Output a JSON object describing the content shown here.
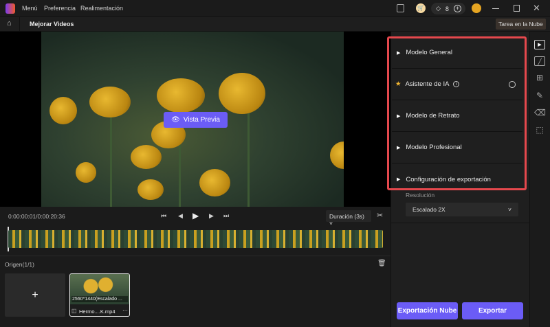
{
  "titlebar": {
    "menu": [
      "Menú",
      "Preferencia",
      "Realimentación"
    ],
    "credits": "8",
    "window_controls": [
      "minimize",
      "maximize",
      "close"
    ]
  },
  "toolbar": {
    "title": "Mejorar Videos",
    "cloud_task": "Tarea en la Nube"
  },
  "preview": {
    "button": "Vista Previa"
  },
  "controls": {
    "time": "0:00:00:01/0:00:20:36",
    "duration": "Duración (3s)"
  },
  "origin": {
    "label": "Origen(1/1)",
    "clip": {
      "resolution": "2560*1440(Escalado ...",
      "name": "Hermo....K.mp4"
    }
  },
  "panel": {
    "items": [
      {
        "label": "Modelo General",
        "icon": "triangle-right"
      },
      {
        "label": "Asistente de IA",
        "icon": "star"
      },
      {
        "label": "Modelo de Retrato",
        "icon": "triangle-right"
      },
      {
        "label": "Modelo Profesional",
        "icon": "triangle-right"
      },
      {
        "label": "Configuración de exportación",
        "icon": "triangle-right"
      }
    ],
    "resolution_label": "Resolución",
    "resolution_value": "Escalado 2X"
  },
  "actions": {
    "cloud_export": "Exportación Nube",
    "export": "Exportar"
  },
  "colors": {
    "accent": "#6b5cf6",
    "highlight": "#e5484d"
  }
}
